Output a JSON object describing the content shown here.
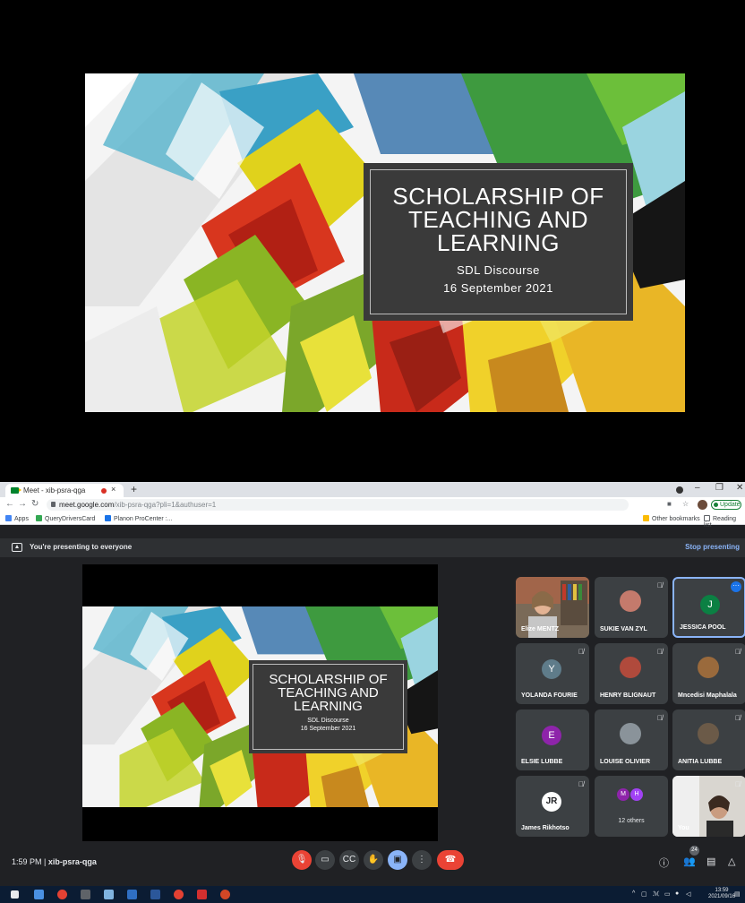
{
  "slide": {
    "title": "SCHOLARSHIP OF TEACHING AND LEARNING",
    "subtitle": "SDL Discourse",
    "date": "16 September 2021"
  },
  "browser": {
    "tab_title": "Meet - xib-psra-qga",
    "tab_close": "×",
    "new_tab": "+",
    "url_host": "meet.google.com",
    "url_path": "/xib-psra-qga?pli=1&authuser=1",
    "update_label": "Update",
    "bookmarks": [
      {
        "label": "Apps",
        "color": "#4285f4"
      },
      {
        "label": "QueryDriversCard",
        "color": "#34a853"
      },
      {
        "label": "Planon ProCenter :...",
        "color": "#1a73e8"
      }
    ],
    "other_bookmarks": "Other bookmarks",
    "reading_list": "Reading list"
  },
  "meet": {
    "presenting_text": "You're presenting to everyone",
    "stop_presenting": "Stop presenting",
    "participants": [
      {
        "name": "Elize MENTZ",
        "type": "camera"
      },
      {
        "name": "SUKIE VAN ZYL",
        "type": "photo",
        "color": "#c47a6c"
      },
      {
        "name": "JESSICA POOL",
        "type": "initial",
        "initial": "J",
        "color": "#0b8043"
      },
      {
        "name": "YOLANDA FOURIE",
        "type": "initial",
        "initial": "Y",
        "color": "#5f7c8a"
      },
      {
        "name": "HENRY BLIGNAUT",
        "type": "photo",
        "color": "#b04a3c"
      },
      {
        "name": "Mncedisi Maphalala",
        "type": "photo",
        "color": "#9a6a3c"
      },
      {
        "name": "ELSIE LUBBE",
        "type": "initial",
        "initial": "E",
        "color": "#8e24aa"
      },
      {
        "name": "LOUISE OLIVIER",
        "type": "photo",
        "color": "#8a939a"
      },
      {
        "name": "ANITIA LUBBE",
        "type": "photo",
        "color": "#6b5a48"
      },
      {
        "name": "James Rikhotso",
        "type": "initial",
        "initial": "JR",
        "color": "#ffffff"
      },
      {
        "name": "12 others",
        "type": "others",
        "initials": [
          "M",
          "H"
        ]
      },
      {
        "name": "You",
        "type": "self"
      }
    ],
    "time": "1:59 PM",
    "separator": "|",
    "meeting_code": "xib-psra-qga",
    "participant_count": "24"
  },
  "taskbar": {
    "time": "13:59",
    "date": "2021/09/16"
  }
}
